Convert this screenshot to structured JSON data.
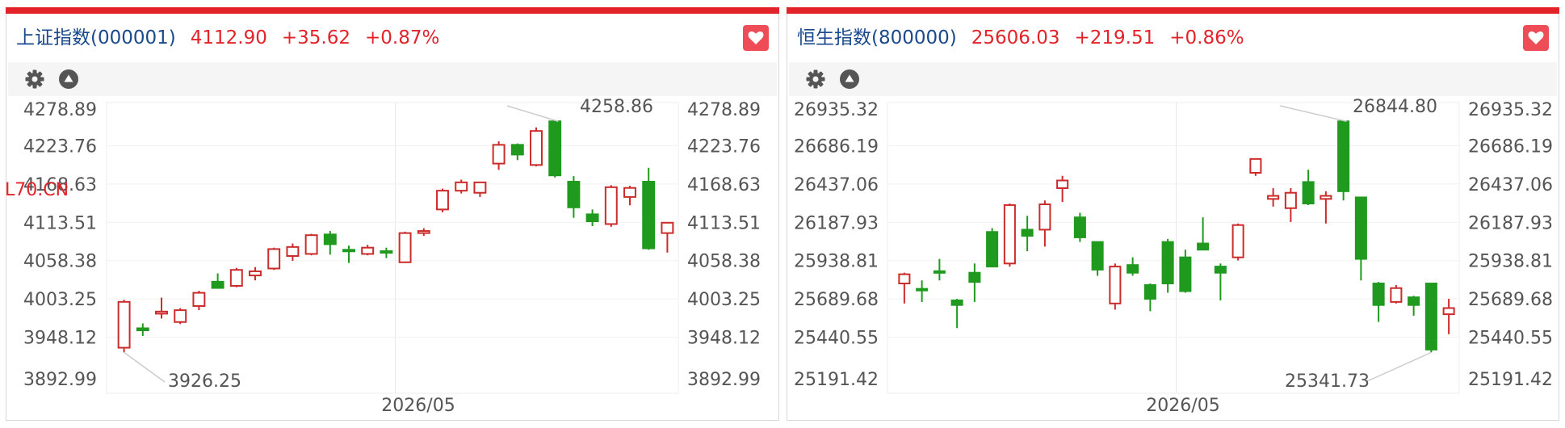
{
  "colors": {
    "up": "#cc2b2b",
    "down": "#1f9a1f",
    "accent": "#e3232a",
    "name": "#1a4a8c"
  },
  "panels": [
    {
      "name": "上证指数(000001)",
      "price": "4112.90",
      "change": "+35.62",
      "change_pct": "+0.87%",
      "overlay_text": "L70.CN",
      "chart_data": {
        "type": "candlestick",
        "yticks": [
          "4278.89",
          "4223.76",
          "4168.63",
          "4113.51",
          "4058.38",
          "4003.25",
          "3948.12",
          "3892.99"
        ],
        "ylim": [
          3892.99,
          4278.89
        ],
        "xtick": "2026/05",
        "max_label": "4258.86",
        "min_label": "3926.25",
        "candles": [
          {
            "o": 3933,
            "h": 4002,
            "l": 3926.25,
            "c": 3999
          },
          {
            "o": 3961,
            "h": 3968,
            "l": 3950,
            "c": 3958
          },
          {
            "o": 3982,
            "h": 4005,
            "l": 3975,
            "c": 3985
          },
          {
            "o": 3970,
            "h": 3990,
            "l": 3967,
            "c": 3987
          },
          {
            "o": 3993,
            "h": 4015,
            "l": 3987,
            "c": 4012
          },
          {
            "o": 4028,
            "h": 4040,
            "l": 4018,
            "c": 4019
          },
          {
            "o": 4022,
            "h": 4048,
            "l": 4020,
            "c": 4045
          },
          {
            "o": 4037,
            "h": 4049,
            "l": 4030,
            "c": 4043
          },
          {
            "o": 4047,
            "h": 4077,
            "l": 4045,
            "c": 4075
          },
          {
            "o": 4065,
            "h": 4083,
            "l": 4058,
            "c": 4078
          },
          {
            "o": 4068,
            "h": 4097,
            "l": 4066,
            "c": 4095
          },
          {
            "o": 4096,
            "h": 4101,
            "l": 4067,
            "c": 4082
          },
          {
            "o": 4074,
            "h": 4080,
            "l": 4055,
            "c": 4073
          },
          {
            "o": 4068,
            "h": 4081,
            "l": 4066,
            "c": 4077
          },
          {
            "o": 4072,
            "h": 4077,
            "l": 4062,
            "c": 4070
          },
          {
            "o": 4056,
            "h": 4100,
            "l": 4055,
            "c": 4098
          },
          {
            "o": 4098,
            "h": 4105,
            "l": 4094,
            "c": 4101
          },
          {
            "o": 4132,
            "h": 4162,
            "l": 4128,
            "c": 4159
          },
          {
            "o": 4159,
            "h": 4175,
            "l": 4155,
            "c": 4171
          },
          {
            "o": 4156,
            "h": 4172,
            "l": 4150,
            "c": 4171
          },
          {
            "o": 4198,
            "h": 4230,
            "l": 4189,
            "c": 4225
          },
          {
            "o": 4225,
            "h": 4227,
            "l": 4203,
            "c": 4211
          },
          {
            "o": 4196,
            "h": 4250,
            "l": 4194,
            "c": 4245
          },
          {
            "o": 4258.86,
            "h": 4258.86,
            "l": 4178,
            "c": 4181
          },
          {
            "o": 4172,
            "h": 4180,
            "l": 4120,
            "c": 4135
          },
          {
            "o": 4125,
            "h": 4132,
            "l": 4108,
            "c": 4115
          },
          {
            "o": 4111,
            "h": 4167,
            "l": 4107,
            "c": 4164
          },
          {
            "o": 4150,
            "h": 4166,
            "l": 4138,
            "c": 4163
          },
          {
            "o": 4172,
            "h": 4192,
            "l": 4074,
            "c": 4076
          },
          {
            "o": 4098,
            "h": 4113,
            "l": 4070,
            "c": 4112.9
          }
        ]
      }
    },
    {
      "name": "恒生指数(800000)",
      "price": "25606.03",
      "change": "+219.51",
      "change_pct": "+0.86%",
      "chart_data": {
        "type": "candlestick",
        "yticks": [
          "26935.32",
          "26686.19",
          "26437.06",
          "26187.93",
          "25938.81",
          "25689.68",
          "25440.55",
          "25191.42"
        ],
        "ylim": [
          25191.42,
          26935.32
        ],
        "xtick": "2026/05",
        "max_label": "26844.80",
        "min_label": "25341.73",
        "candles": [
          {
            "o": 25790,
            "h": 25860,
            "l": 25660,
            "c": 25850
          },
          {
            "o": 25755,
            "h": 25810,
            "l": 25670,
            "c": 25745
          },
          {
            "o": 25870,
            "h": 25950,
            "l": 25810,
            "c": 25865
          },
          {
            "o": 25680,
            "h": 25690,
            "l": 25500,
            "c": 25650
          },
          {
            "o": 25860,
            "h": 25920,
            "l": 25670,
            "c": 25800
          },
          {
            "o": 26125,
            "h": 26150,
            "l": 25900,
            "c": 25900
          },
          {
            "o": 25920,
            "h": 26310,
            "l": 25900,
            "c": 26300
          },
          {
            "o": 26140,
            "h": 26230,
            "l": 26000,
            "c": 26100
          },
          {
            "o": 26140,
            "h": 26330,
            "l": 26030,
            "c": 26305
          },
          {
            "o": 26410,
            "h": 26490,
            "l": 26320,
            "c": 26460
          },
          {
            "o": 26220,
            "h": 26250,
            "l": 26060,
            "c": 26090
          },
          {
            "o": 26060,
            "h": 26060,
            "l": 25840,
            "c": 25880
          },
          {
            "o": 25660,
            "h": 25920,
            "l": 25620,
            "c": 25900
          },
          {
            "o": 25910,
            "h": 25960,
            "l": 25840,
            "c": 25860
          },
          {
            "o": 25780,
            "h": 25790,
            "l": 25610,
            "c": 25690
          },
          {
            "o": 26060,
            "h": 26080,
            "l": 25730,
            "c": 25790
          },
          {
            "o": 25960,
            "h": 26010,
            "l": 25730,
            "c": 25740
          },
          {
            "o": 26050,
            "h": 26220,
            "l": 26010,
            "c": 26010
          },
          {
            "o": 25900,
            "h": 25920,
            "l": 25680,
            "c": 25860
          },
          {
            "o": 25960,
            "h": 26180,
            "l": 25940,
            "c": 26170
          },
          {
            "o": 26510,
            "h": 26600,
            "l": 26490,
            "c": 26600
          },
          {
            "o": 26340,
            "h": 26410,
            "l": 26290,
            "c": 26360
          },
          {
            "o": 26280,
            "h": 26410,
            "l": 26190,
            "c": 26380
          },
          {
            "o": 26450,
            "h": 26530,
            "l": 26300,
            "c": 26310
          },
          {
            "o": 26340,
            "h": 26390,
            "l": 26180,
            "c": 26360
          },
          {
            "o": 26844.8,
            "h": 26844.8,
            "l": 26330,
            "c": 26390
          },
          {
            "o": 26350,
            "h": 26350,
            "l": 25810,
            "c": 25950
          },
          {
            "o": 25790,
            "h": 25800,
            "l": 25540,
            "c": 25650
          },
          {
            "o": 25670,
            "h": 25780,
            "l": 25660,
            "c": 25760
          },
          {
            "o": 25700,
            "h": 25710,
            "l": 25580,
            "c": 25650
          },
          {
            "o": 25790,
            "h": 25790,
            "l": 25341.73,
            "c": 25360
          },
          {
            "o": 25590,
            "h": 25690,
            "l": 25460,
            "c": 25630
          }
        ]
      }
    }
  ]
}
